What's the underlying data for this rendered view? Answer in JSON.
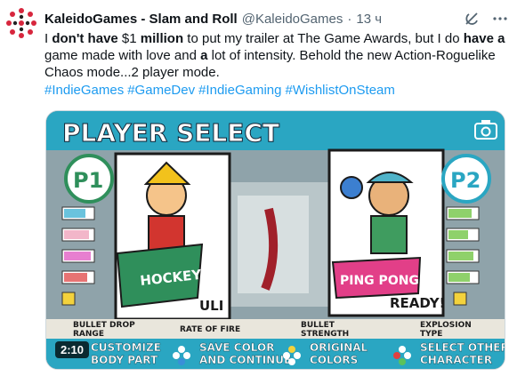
{
  "tweet": {
    "author_name": "KaleidoGames - Slam and Roll",
    "handle": "@KaleidoGames",
    "separator": "·",
    "time": "13 ч",
    "text": {
      "p1": "I ",
      "b1": "don't have",
      "p2": " $1 ",
      "b2": "million",
      "p3": " to put my trailer at The Game Awards, but I do ",
      "b3": "have a",
      "p4": " game made with love and ",
      "b4": "a",
      "p5": " lot of intensity. Behold the new Action-Roguelike Chaos mode...2 player mode."
    },
    "hashtags": [
      "#IndieGames",
      "#GameDev",
      "#IndieGaming",
      "#WishlistOnSteam"
    ]
  },
  "media": {
    "title": "PLAYER SELECT",
    "p1": {
      "badge": "P1",
      "weapon": "HOCKEY",
      "name": "ULI"
    },
    "p2": {
      "badge": "P2",
      "weapon": "PING PONG",
      "status": "READY!"
    },
    "legend": [
      "BULLET DROP",
      "RANGE",
      "RATE OF FIRE",
      "BULLET",
      "STRENGTH",
      "EXPLOSION",
      "TYPE"
    ],
    "controls": [
      "CUSTOMIZE",
      "BODY PART",
      "SAVE COLOR",
      "AND CONTINUE",
      "ORIGINAL",
      "COLORS",
      "SELECT OTHER",
      "CHARACTER"
    ],
    "duration": "2:10"
  },
  "colors": {
    "accent_link": "#1d9bf0",
    "title_bar": "#2aa6c2",
    "card_green": "#2f8f5b",
    "card_pink": "#e23f88"
  },
  "icons": {
    "avatar": "kaleido-logo",
    "grok": "grok-icon",
    "more": "more-icon",
    "camera": "camera-icon"
  }
}
